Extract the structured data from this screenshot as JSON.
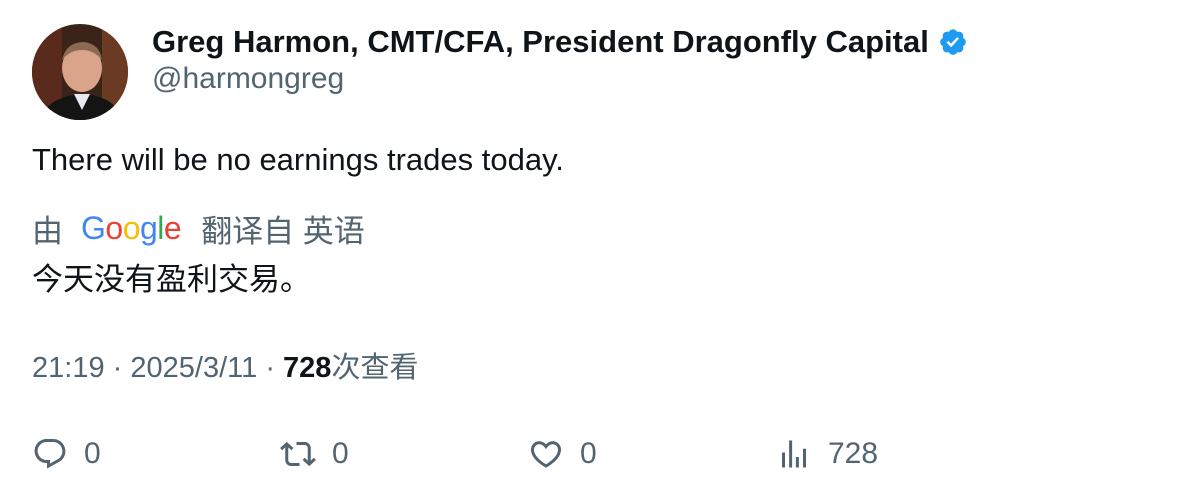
{
  "author": {
    "display_name": "Greg Harmon, CMT/CFA, President Dragonfly Capital",
    "handle": "@harmongreg",
    "verified": true
  },
  "tweet": {
    "text": "There will be no earnings trades today."
  },
  "translation": {
    "by_label": "由",
    "provider": "Google",
    "from_label": "翻译自 英语",
    "text": "今天没有盈利交易。"
  },
  "meta": {
    "time": "21:19",
    "separator": "·",
    "date": "2025/3/11",
    "views_count": "728",
    "views_label": "次查看"
  },
  "actions": {
    "reply_count": "0",
    "retweet_count": "0",
    "like_count": "0",
    "views_count": "728"
  },
  "colors": {
    "text_primary": "#0f1419",
    "text_secondary": "#536471",
    "verified_blue": "#1d9bf0",
    "google_blue": "#4285f4",
    "google_red": "#ea4335",
    "google_yellow": "#fbbc05",
    "google_green": "#34a853"
  }
}
